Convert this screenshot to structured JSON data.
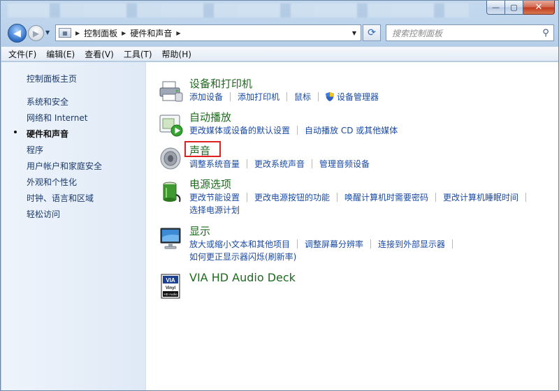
{
  "window": {
    "caption_minimize": "—",
    "caption_maximize": "▢",
    "caption_close": "✕"
  },
  "nav": {
    "back_glyph": "◀",
    "forward_glyph": "▶",
    "history_glyph": "▼",
    "breadcrumb": [
      "控制面板",
      "硬件和声音"
    ],
    "crumb_sep": "▶",
    "dropdown_glyph": "▼",
    "refresh_glyph": "⟳",
    "search_placeholder": "搜索控制面板",
    "search_glyph": "⚲"
  },
  "menu": [
    "文件(F)",
    "编辑(E)",
    "查看(V)",
    "工具(T)",
    "帮助(H)"
  ],
  "sidebar": {
    "items": [
      {
        "label": "控制面板主页",
        "current": false
      },
      {
        "label": "系统和安全",
        "current": false
      },
      {
        "label": "网络和 Internet",
        "current": false
      },
      {
        "label": "硬件和声音",
        "current": true
      },
      {
        "label": "程序",
        "current": false
      },
      {
        "label": "用户帐户和家庭安全",
        "current": false
      },
      {
        "label": "外观和个性化",
        "current": false
      },
      {
        "label": "时钟、语言和区域",
        "current": false
      },
      {
        "label": "轻松访问",
        "current": false
      }
    ]
  },
  "sections": [
    {
      "title": "设备和打印机",
      "icon": "printer-icon",
      "links": [
        "添加设备",
        "添加打印机",
        "鼠标",
        "设备管理器"
      ],
      "links2": []
    },
    {
      "title": "自动播放",
      "icon": "autoplay-icon",
      "links": [
        "更改媒体或设备的默认设置",
        "自动播放 CD 或其他媒体"
      ],
      "links2": []
    },
    {
      "title": "声音",
      "icon": "speaker-icon",
      "links": [
        "调整系统音量",
        "更改系统声音",
        "管理音频设备"
      ],
      "links2": []
    },
    {
      "title": "电源选项",
      "icon": "battery-icon",
      "links": [
        "更改节能设置",
        "更改电源按钮的功能",
        "唤醒计算机时需要密码",
        "更改计算机睡眠时间"
      ],
      "links2": [
        "选择电源计划"
      ]
    },
    {
      "title": "显示",
      "icon": "monitor-icon",
      "links": [
        "放大或缩小文本和其他项目",
        "调整屏幕分辨率",
        "连接到外部显示器"
      ],
      "links2": [
        "如何更正显示器闪烁(刷新率)"
      ]
    },
    {
      "title": "VIA HD Audio Deck",
      "icon": "via-audio-icon",
      "links": [],
      "links2": []
    }
  ],
  "via_logo": {
    "line1": "VIA",
    "line2": "Vinyl",
    "line3": "HD Audio"
  }
}
